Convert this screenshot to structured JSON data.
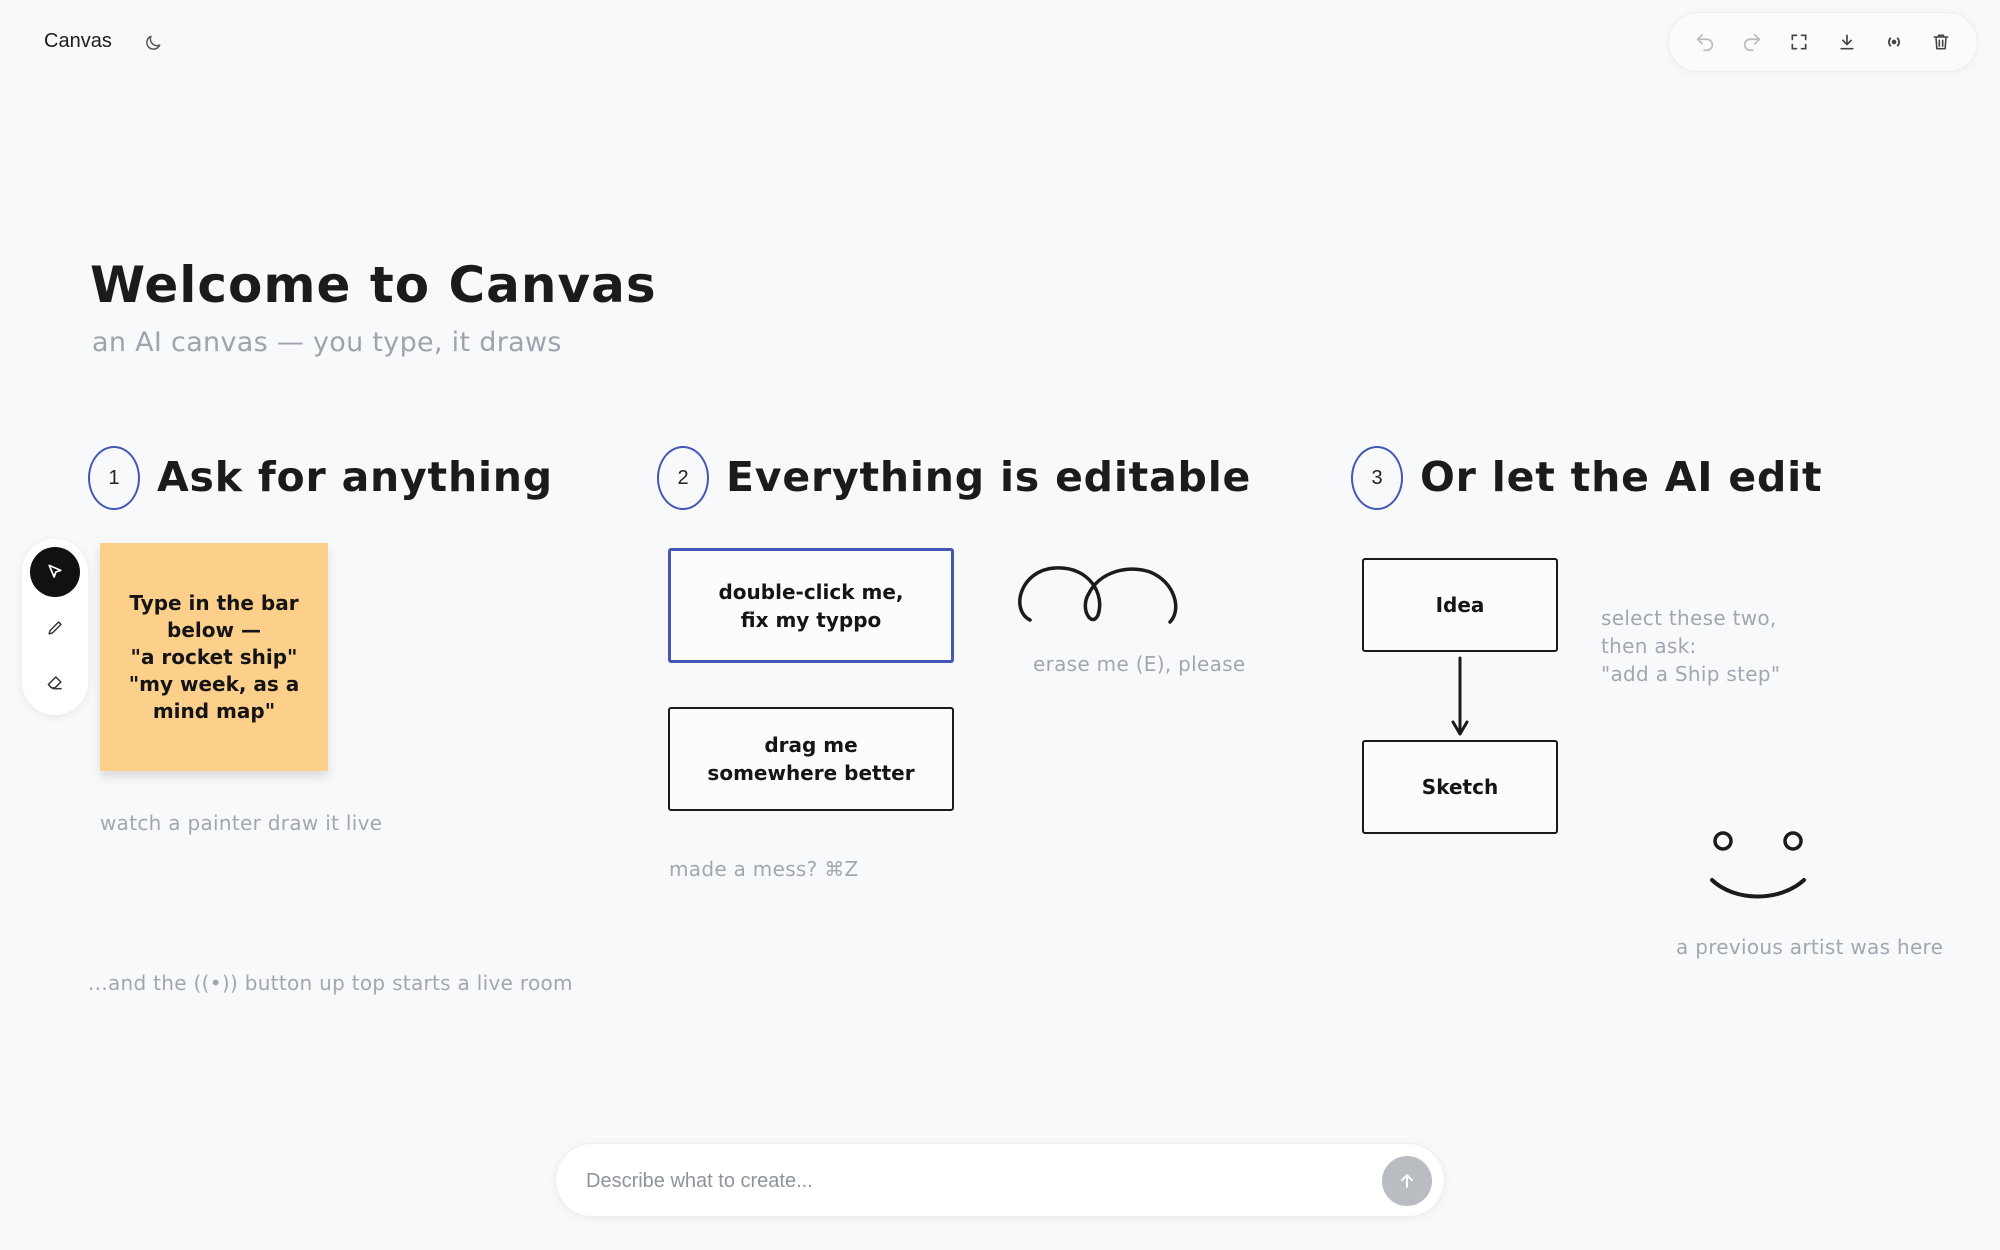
{
  "app": {
    "title": "Canvas"
  },
  "toolbar": {
    "icons": [
      "undo-icon",
      "redo-icon",
      "fullscreen-icon",
      "download-icon",
      "live-room-icon",
      "trash-icon"
    ]
  },
  "tools": {
    "icons": [
      "select-arrow-icon",
      "pencil-icon",
      "eraser-icon"
    ],
    "active": "select"
  },
  "canvas": {
    "welcome_title": "Welcome to Canvas",
    "subtitle": "an AI canvas — you type, it draws",
    "steps": [
      {
        "number": "1",
        "title": "Ask for anything"
      },
      {
        "number": "2",
        "title": "Everything is editable"
      },
      {
        "number": "3",
        "title": "Or let the AI edit"
      }
    ],
    "sticky_note": {
      "lines": [
        "Type in the bar",
        "below —",
        "\"a rocket ship\"",
        "\"my week, as a",
        "mind map\""
      ]
    },
    "watch_text": "watch a painter draw it live",
    "live_room_text": "...and the ((•)) button up top starts a live room",
    "edit_box_lines": [
      "double-click me,",
      "fix my typpo"
    ],
    "drag_box_lines": [
      "drag me",
      "somewhere better"
    ],
    "erase_text": "erase me (E), please",
    "mess_text": "made a mess? ⌘Z",
    "flow": {
      "first": "Idea",
      "second": "Sketch"
    },
    "select_hint_lines": [
      "select these two,",
      "then ask:",
      "\"add a Ship step\""
    ],
    "artist_text": "a previous artist was here"
  },
  "prompt": {
    "placeholder": "Describe what to create..."
  },
  "colors": {
    "accent": "#4457b5",
    "sticky": "#fccf8a",
    "muted_text": "#a1a7b0",
    "background": "#f8f9fb"
  }
}
